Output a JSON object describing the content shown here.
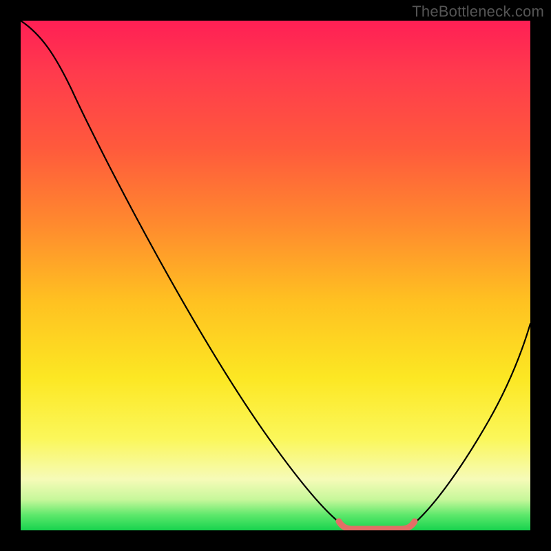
{
  "watermark": "TheBottleneck.com",
  "chart_data": {
    "type": "line",
    "title": "",
    "xlabel": "",
    "ylabel": "",
    "xlim": [
      0,
      100
    ],
    "ylim": [
      0,
      100
    ],
    "x": [
      0,
      5,
      10,
      15,
      20,
      25,
      30,
      35,
      40,
      45,
      50,
      55,
      60,
      63,
      67,
      70,
      73,
      78,
      83,
      88,
      93,
      100
    ],
    "values": [
      100,
      98,
      93,
      86,
      78,
      70,
      62,
      54,
      46,
      38,
      30,
      22,
      14,
      7,
      2,
      0,
      0,
      1,
      8,
      18,
      28,
      42
    ],
    "flat_region": {
      "x_start": 62,
      "x_end": 76,
      "y": 0,
      "color": "#e36f66"
    },
    "gradient_stops": [
      {
        "pos": 0,
        "color": "#ff1f55"
      },
      {
        "pos": 10,
        "color": "#ff3a4d"
      },
      {
        "pos": 25,
        "color": "#ff5a3c"
      },
      {
        "pos": 40,
        "color": "#ff8a2e"
      },
      {
        "pos": 55,
        "color": "#ffc121"
      },
      {
        "pos": 70,
        "color": "#fce723"
      },
      {
        "pos": 82,
        "color": "#fbf75a"
      },
      {
        "pos": 90,
        "color": "#f6fbb8"
      },
      {
        "pos": 94,
        "color": "#c6f79a"
      },
      {
        "pos": 97,
        "color": "#5de86b"
      },
      {
        "pos": 100,
        "color": "#17d34e"
      }
    ]
  }
}
